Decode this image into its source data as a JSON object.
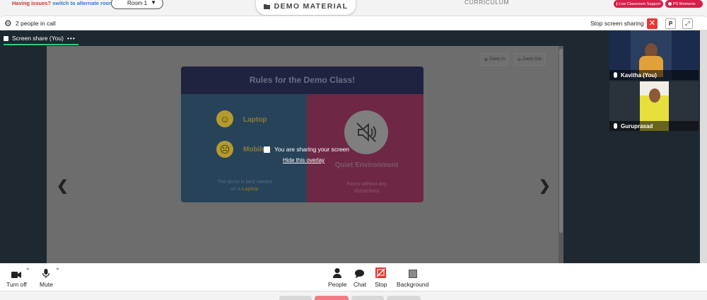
{
  "topbar": {
    "issues_text": "Having issues?",
    "issues_link": "switch to alternate room",
    "room_select": "Room 1",
    "demo_material": "DEMO MATERIAL",
    "curriculum": "CURRICULUM",
    "live_support": "Live Classroom Support",
    "moments": "PS Moments"
  },
  "call_header": {
    "people_count": "2 people in call",
    "stop_sharing": "Stop screen sharing",
    "p_button": "P"
  },
  "stage": {
    "share_tab": "Screen share (You)",
    "share_tab_more": "•••",
    "zoom_in": "Zoom In",
    "zoom_out": "Zoom Out",
    "slide": {
      "title": "Rules for the Demo Class!",
      "laptop": "Laptop",
      "mobile": "Mobile",
      "note_left_1": "The demo is best viewed",
      "note_left_2": "on a",
      "note_left_bold": "Laptop",
      "quiet": "Quiet Environment",
      "note_right": "Focus without any distractions"
    },
    "overlay_msg": "You are sharing your screen",
    "overlay_link": "Hide this overlay"
  },
  "participants": [
    {
      "name": "Kavitha (You)"
    },
    {
      "name": "Guruprasad"
    }
  ],
  "toolbar": {
    "turn_off": "Turn off",
    "mute": "Mute",
    "people": "People",
    "chat": "Chat",
    "stop": "Stop",
    "background": "Background"
  },
  "colors": {
    "stop_red": "#e53935",
    "brand_pink": "#d71f4a",
    "active_tab": "#2ecc71"
  }
}
